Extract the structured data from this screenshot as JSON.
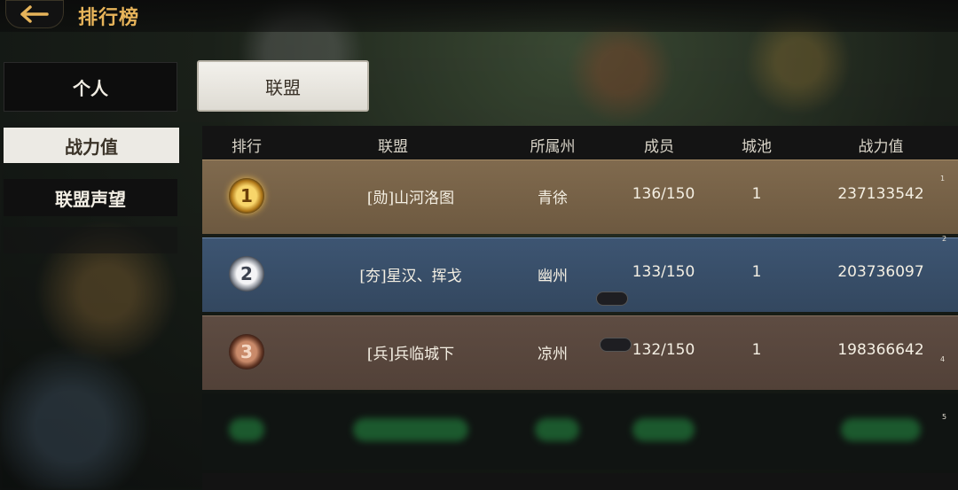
{
  "header": {
    "title": "排行榜"
  },
  "sidebar": {
    "tabs": [
      {
        "label": "个人"
      },
      {
        "label": "战力值"
      },
      {
        "label": "联盟声望"
      }
    ]
  },
  "top_tab": {
    "label": "联盟"
  },
  "table": {
    "columns": [
      "排行",
      "联盟",
      "所属州",
      "成员",
      "城池",
      "战力值"
    ],
    "rows": [
      {
        "rank": "1",
        "alliance": "[勋]山河洛图",
        "state": "青徐",
        "members": "136/150",
        "cities": "1",
        "power": "237133542",
        "side_num": "1"
      },
      {
        "rank": "2",
        "alliance": "[夯]星汉、挥戈",
        "state": "幽州",
        "members": "133/150",
        "cities": "1",
        "power": "203736097",
        "side_num": "2"
      },
      {
        "rank": "3",
        "alliance": "[兵]兵临城下",
        "state": "凉州",
        "members": "132/150",
        "cities": "1",
        "power": "198366642",
        "side_num": "4"
      }
    ],
    "row4_side_num": "5"
  },
  "colors": {
    "title": "#e7b45a",
    "row1": "#806a4e",
    "row2": "#3d5572",
    "row3": "#5e4c42"
  },
  "icons": {
    "back": "back-arrow-icon",
    "medal1": "gold-medal-icon",
    "medal2": "silver-medal-icon",
    "medal3": "bronze-medal-icon"
  }
}
